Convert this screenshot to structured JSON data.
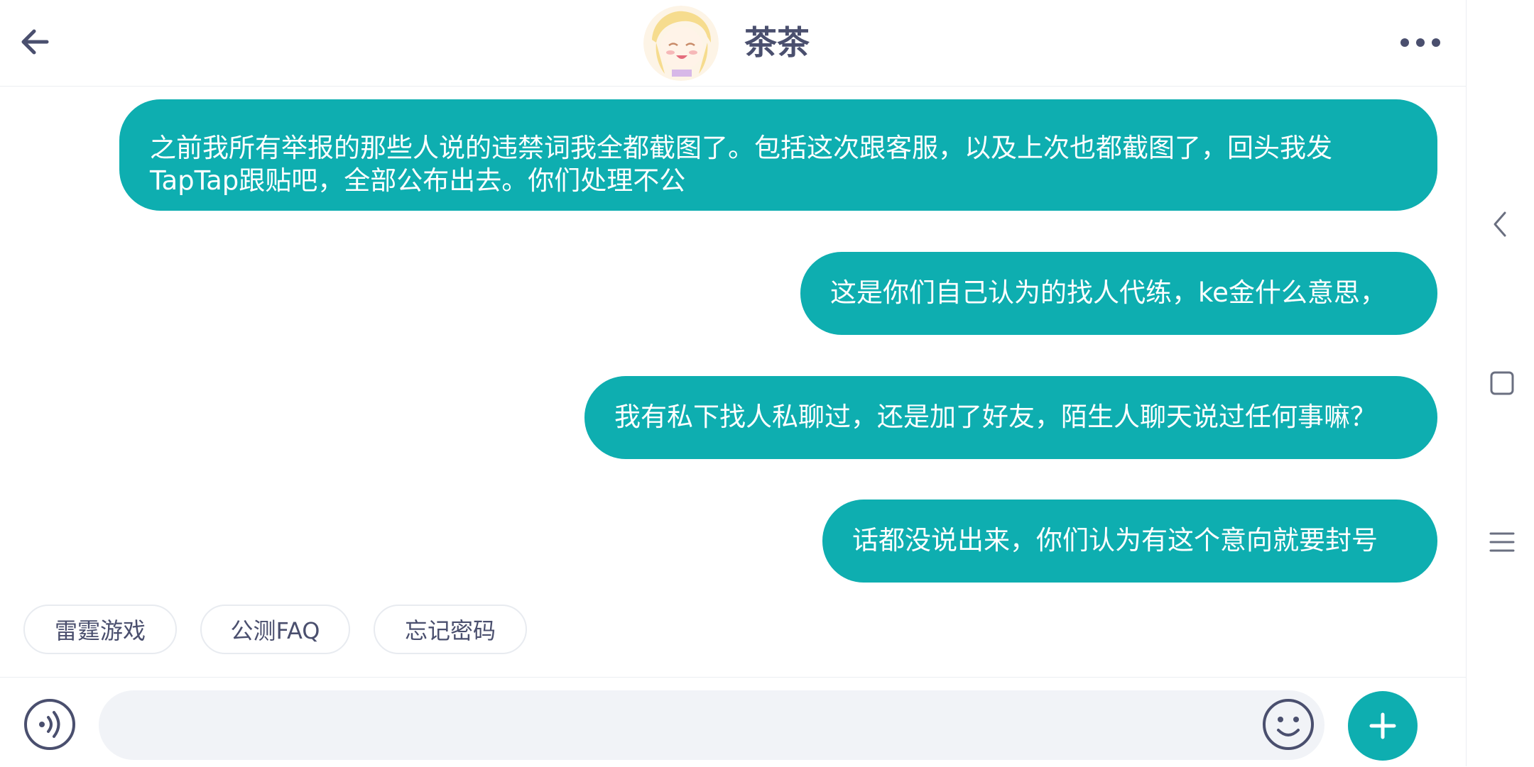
{
  "header": {
    "contact_name": "茶茶",
    "back_icon": "arrow-left-icon",
    "more_icon": "more-horizontal-icon"
  },
  "messages": [
    {
      "lines": [
        "之前我所有举报的那些人说的违禁词我全都截图了。包括这次跟客服，以及上次也都截图了，回头我发",
        "TapTap跟贴吧，全部公布出去。你们处理不公"
      ]
    },
    {
      "lines": [
        "这是你们自己认为的找人代练，ke金什么意思，"
      ]
    },
    {
      "lines": [
        "我有私下找人私聊过，还是加了好友，陌生人聊天说过任何事嘛？"
      ]
    },
    {
      "lines": [
        "话都没说出来，你们认为有这个意向就要封号"
      ]
    }
  ],
  "quick_replies": [
    "雷霆游戏",
    "公测FAQ",
    "忘记密码"
  ],
  "composer": {
    "placeholder": "",
    "voice_icon": "voice-icon",
    "emoji_icon": "emoji-icon",
    "plus_icon": "plus-icon"
  },
  "colors": {
    "accent": "#0eaeb0",
    "text_dark": "#4a4f6e",
    "input_bg": "#f1f3f7"
  }
}
